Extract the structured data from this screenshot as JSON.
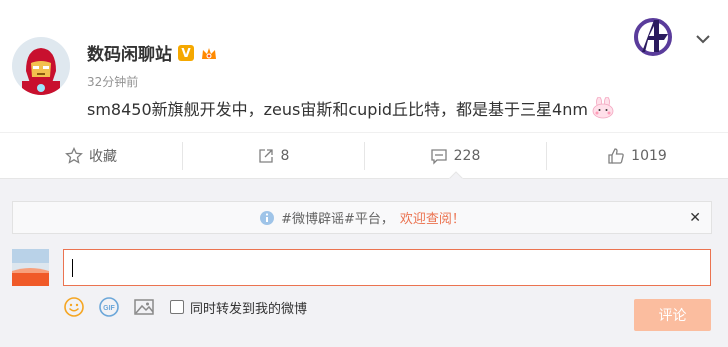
{
  "post": {
    "author": "数码闲聊站",
    "vip_badge": "V",
    "time": "32分钟前",
    "text": "sm8450新旗舰开发中，zeus宙斯和cupid丘比特，都是基于三星4nm",
    "emoji": "rabbit-emoji"
  },
  "actions": {
    "favorite_label": "收藏",
    "repost_count": "8",
    "comment_count": "228",
    "like_count": "1019"
  },
  "comment": {
    "notice_prefix": "#微博辟谣#平台，",
    "notice_link": "欢迎查阅！",
    "notice_close": "✕",
    "repost_checkbox_label": "同时转发到我的微博",
    "submit_label": "评论"
  },
  "colors": {
    "accent": "#eb7350",
    "submit_disabled": "#fbbd9f",
    "vip": "#f5a800",
    "panel_bg": "#f2f2f5"
  }
}
